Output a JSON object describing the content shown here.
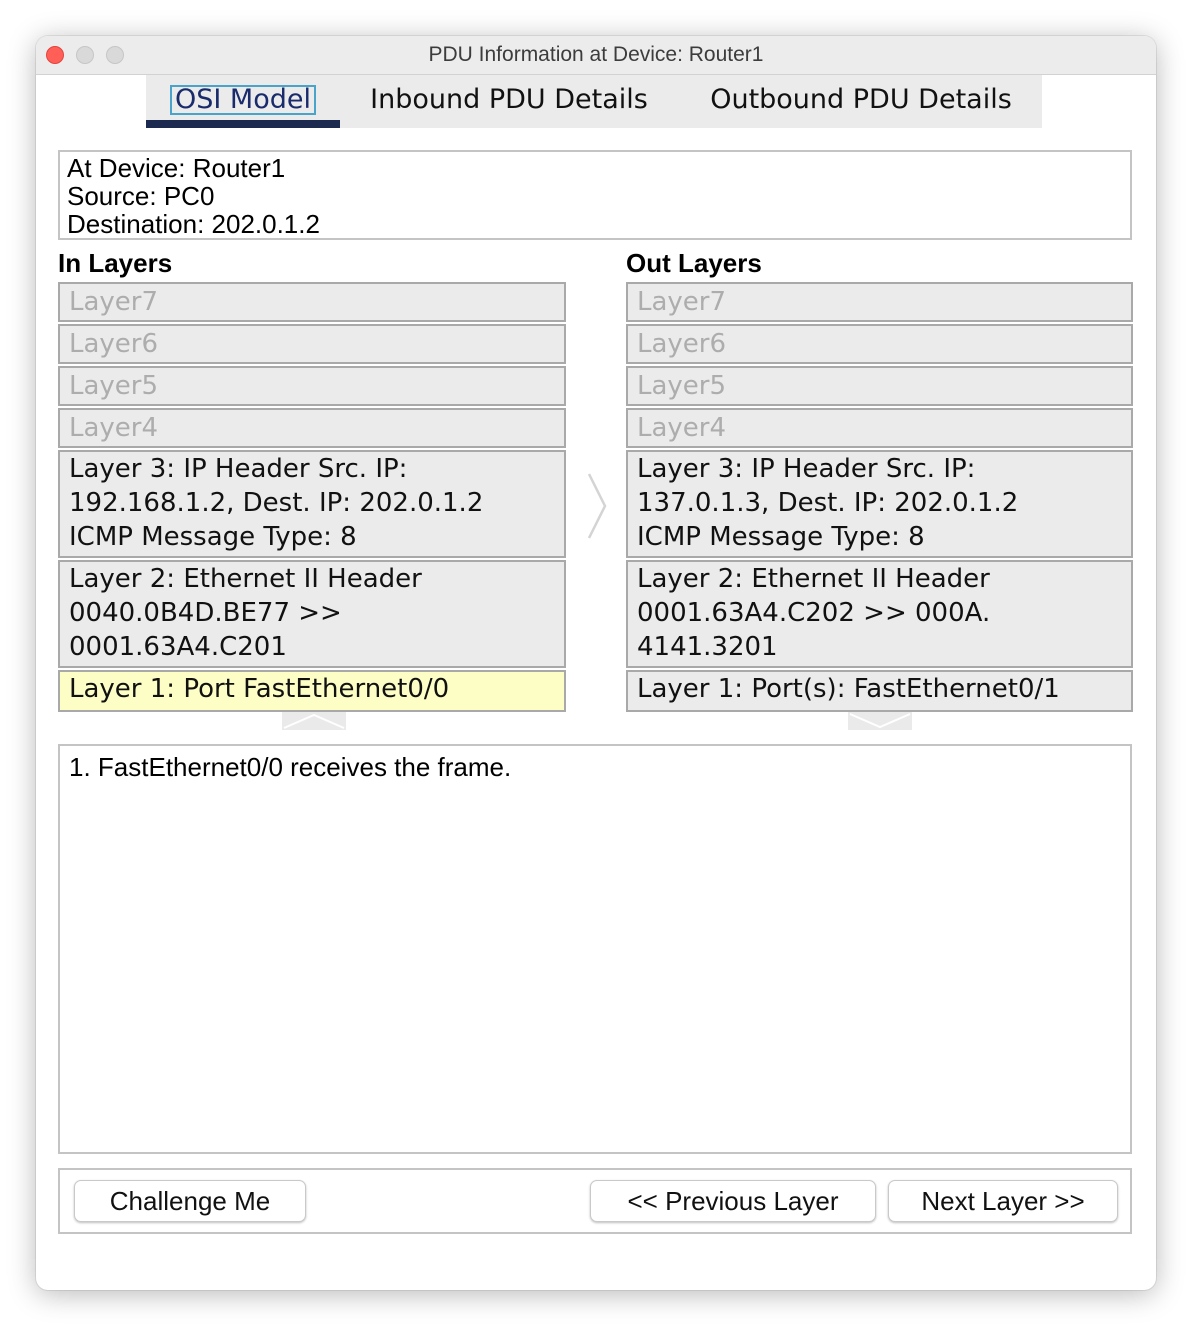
{
  "window": {
    "title": "PDU Information at Device: Router1"
  },
  "tabs": [
    {
      "label": "OSI Model",
      "selected": true
    },
    {
      "label": "Inbound PDU Details",
      "selected": false
    },
    {
      "label": "Outbound PDU Details",
      "selected": false
    }
  ],
  "info": {
    "at_device": "At Device: Router1",
    "source": "Source: PC0",
    "destination": "Destination: 202.0.1.2"
  },
  "in_layers": {
    "heading": "In Layers",
    "layer7": "Layer7",
    "layer6": "Layer6",
    "layer5": "Layer5",
    "layer4": "Layer4",
    "layer3": [
      "Layer 3: IP Header Src. IP:",
      "192.168.1.2, Dest. IP: 202.0.1.2",
      "ICMP Message Type: 8"
    ],
    "layer2": [
      "Layer 2: Ethernet II Header",
      "0040.0B4D.BE77 >>",
      "0001.63A4.C201"
    ],
    "layer1": "Layer 1: Port FastEthernet0/0"
  },
  "out_layers": {
    "heading": "Out Layers",
    "layer7": "Layer7",
    "layer6": "Layer6",
    "layer5": "Layer5",
    "layer4": "Layer4",
    "layer3": [
      "Layer 3: IP Header Src. IP:",
      "137.0.1.3, Dest. IP: 202.0.1.2",
      "ICMP Message Type: 8"
    ],
    "layer2": [
      "Layer 2: Ethernet II Header",
      "0001.63A4.C202 >> 000A.",
      "4141.3201"
    ],
    "layer1": "Layer 1: Port(s): FastEthernet0/1"
  },
  "description": "1. FastEthernet0/0 receives the frame.",
  "buttons": {
    "challenge": "Challenge Me",
    "previous": "<< Previous Layer",
    "next": "Next Layer >>"
  },
  "colors": {
    "active_layer": "#fdfdc6",
    "layer_bg": "#ebebeb",
    "tab_underline": "#1b2a4e",
    "close_button": "#ff5f57"
  }
}
